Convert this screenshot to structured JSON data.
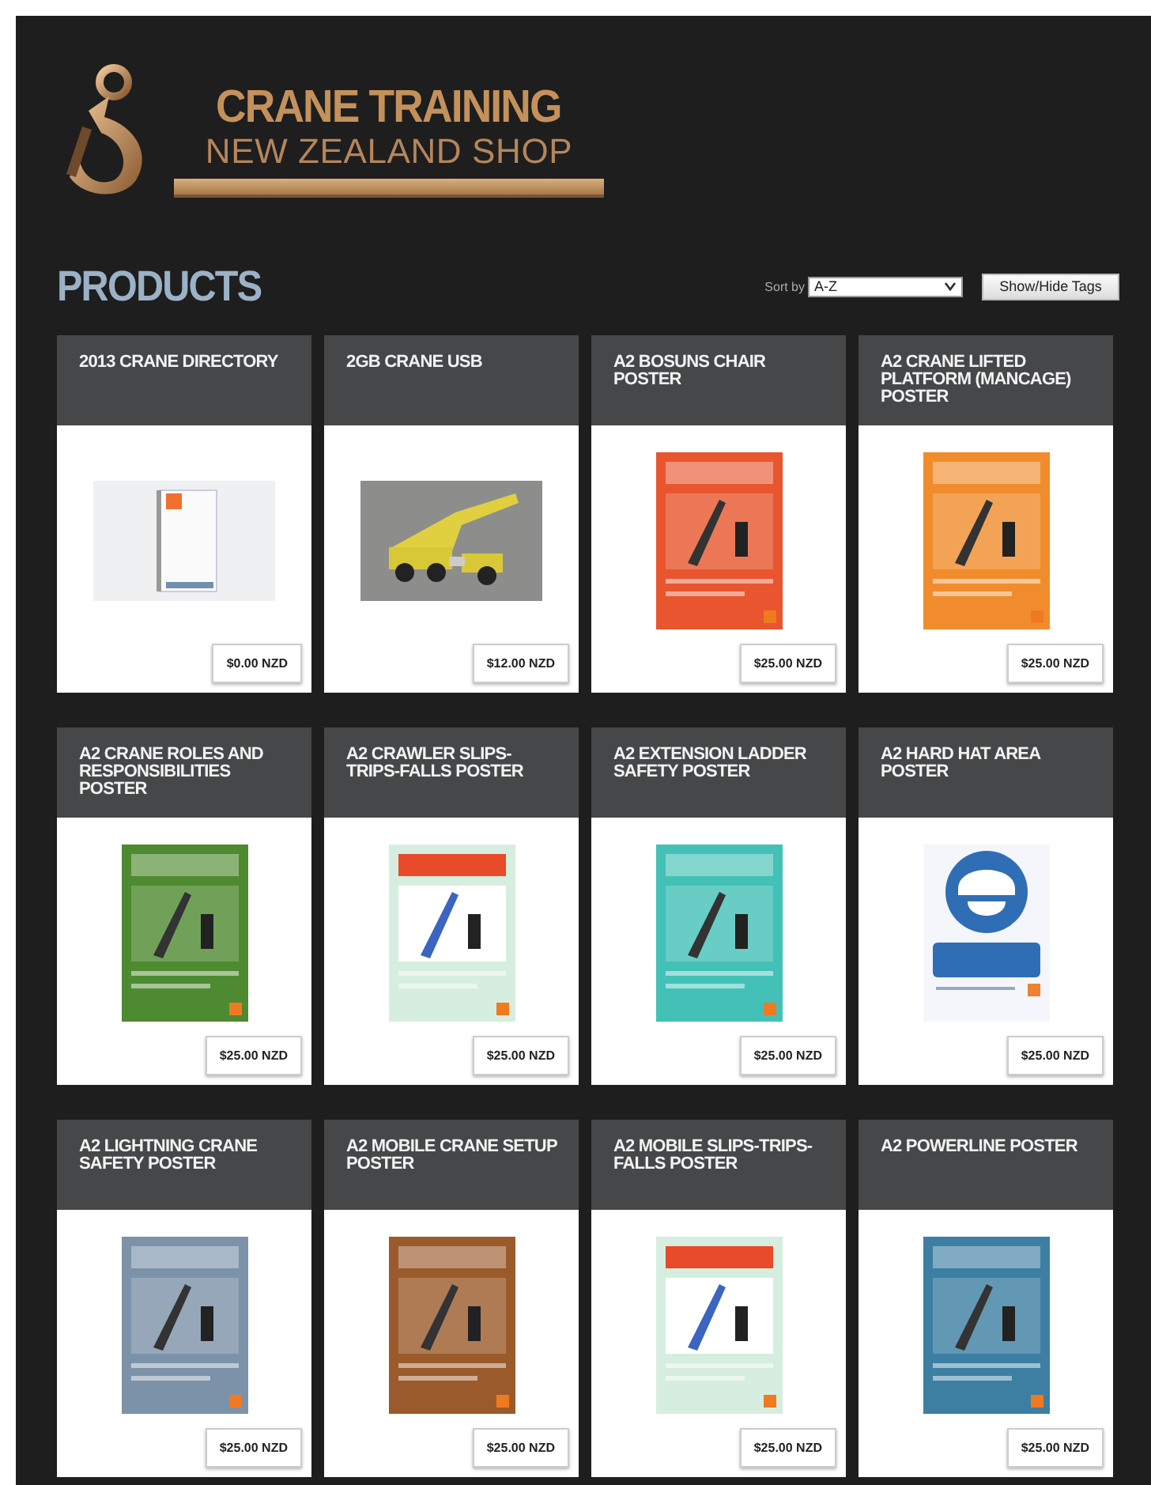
{
  "header": {
    "logo_line_1": "CRANE TRAINING",
    "logo_line_2": "NEW ZEALAND SHOP"
  },
  "heading": "PRODUCTS",
  "sort": {
    "label": "Sort by",
    "value": "A-Z"
  },
  "tags_button": "Show/Hide Tags",
  "products": [
    {
      "title": "2013 CRANE DIRECTORY",
      "price": "$0.00 NZD"
    },
    {
      "title": "2GB CRANE USB",
      "price": "$12.00 NZD"
    },
    {
      "title": "A2 BOSUNS CHAIR POSTER",
      "price": "$25.00 NZD"
    },
    {
      "title": "A2 CRANE LIFTED PLATFORM (MANCAGE) POSTER",
      "price": "$25.00 NZD"
    },
    {
      "title": "A2 CRANE ROLES AND RESPONSIBILITIES POSTER",
      "price": "$25.00 NZD"
    },
    {
      "title": "A2 CRAWLER SLIPS-TRIPS-FALLS POSTER",
      "price": "$25.00 NZD"
    },
    {
      "title": "A2 EXTENSION LADDER SAFETY POSTER",
      "price": "$25.00 NZD"
    },
    {
      "title": "A2 HARD HAT AREA POSTER",
      "price": "$25.00 NZD"
    },
    {
      "title": "A2 LIGHTNING CRANE SAFETY POSTER",
      "price": "$25.00 NZD"
    },
    {
      "title": "A2 MOBILE CRANE SETUP POSTER",
      "price": "$25.00 NZD"
    },
    {
      "title": "A2 MOBILE SLIPS-TRIPS-FALLS POSTER",
      "price": "$25.00 NZD"
    },
    {
      "title": "A2 POWERLINE POSTER",
      "price": "$25.00 NZD"
    }
  ]
}
